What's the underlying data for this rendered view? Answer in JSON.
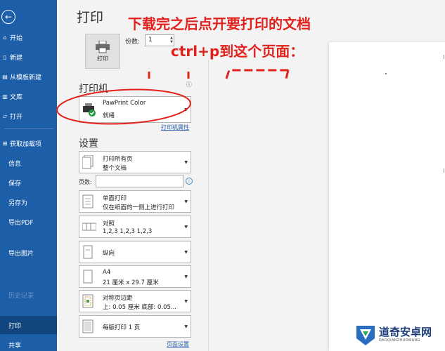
{
  "sidebar": {
    "back_glyph": "←",
    "items": [
      {
        "label": "开始",
        "icon": "home-icon"
      },
      {
        "label": "新建",
        "icon": "new-document-icon"
      },
      {
        "label": "从模板新建",
        "icon": "template-icon"
      },
      {
        "label": "文库",
        "icon": "library-icon"
      },
      {
        "label": "打开",
        "icon": "folder-icon"
      },
      {
        "label": "获取加载项",
        "icon": "add-ins-icon"
      },
      {
        "label": "信息"
      },
      {
        "label": "保存"
      },
      {
        "label": "另存为"
      },
      {
        "label": "导出PDF"
      },
      {
        "label": "导出图片"
      },
      {
        "label": "历史记录",
        "disabled": true
      },
      {
        "label": "打印",
        "active": true
      },
      {
        "label": "共享"
      }
    ]
  },
  "main": {
    "title": "打印",
    "print_button_label": "打印",
    "copies_label": "份数:",
    "copies_value": "1",
    "printer_section": "打印机",
    "printer": {
      "name": "PawPrint Color",
      "status": "就绪"
    },
    "printer_properties_link": "打印机属性",
    "settings_section": "设置",
    "pages_label": "页数:",
    "pages_info_glyph": "i",
    "page_setup_link": "页面设置",
    "settings": [
      {
        "line1": "打印所有页",
        "line2": "整个文档"
      },
      {
        "line1": "单面打印",
        "line2": "仅在纸面的一侧上进行打印"
      },
      {
        "line1": "对照",
        "line2": "1,2,3    1,2,3    1,2,3"
      },
      {
        "line1": "纵向",
        "line2": ""
      },
      {
        "line1": "A4",
        "line2": "21 厘米 x 29.7 厘米"
      },
      {
        "line1": "对称页边距",
        "line2": "上: 0.05 厘米 底部: 0.05..."
      },
      {
        "line1": "每版打印 1 页",
        "line2": ""
      }
    ]
  },
  "annotation": {
    "line1": "下载完之后点开要打印的文档",
    "line2": "ctrl+p到这个页面：",
    "color": "#e2211c"
  },
  "watermark": {
    "title": "道奇安卓网",
    "subtitle": "DAOQIANZHUOWANG"
  },
  "colors": {
    "sidebar": "#1d5ea8",
    "sidebar_active": "#11457e",
    "accent_link": "#2b5fae"
  }
}
